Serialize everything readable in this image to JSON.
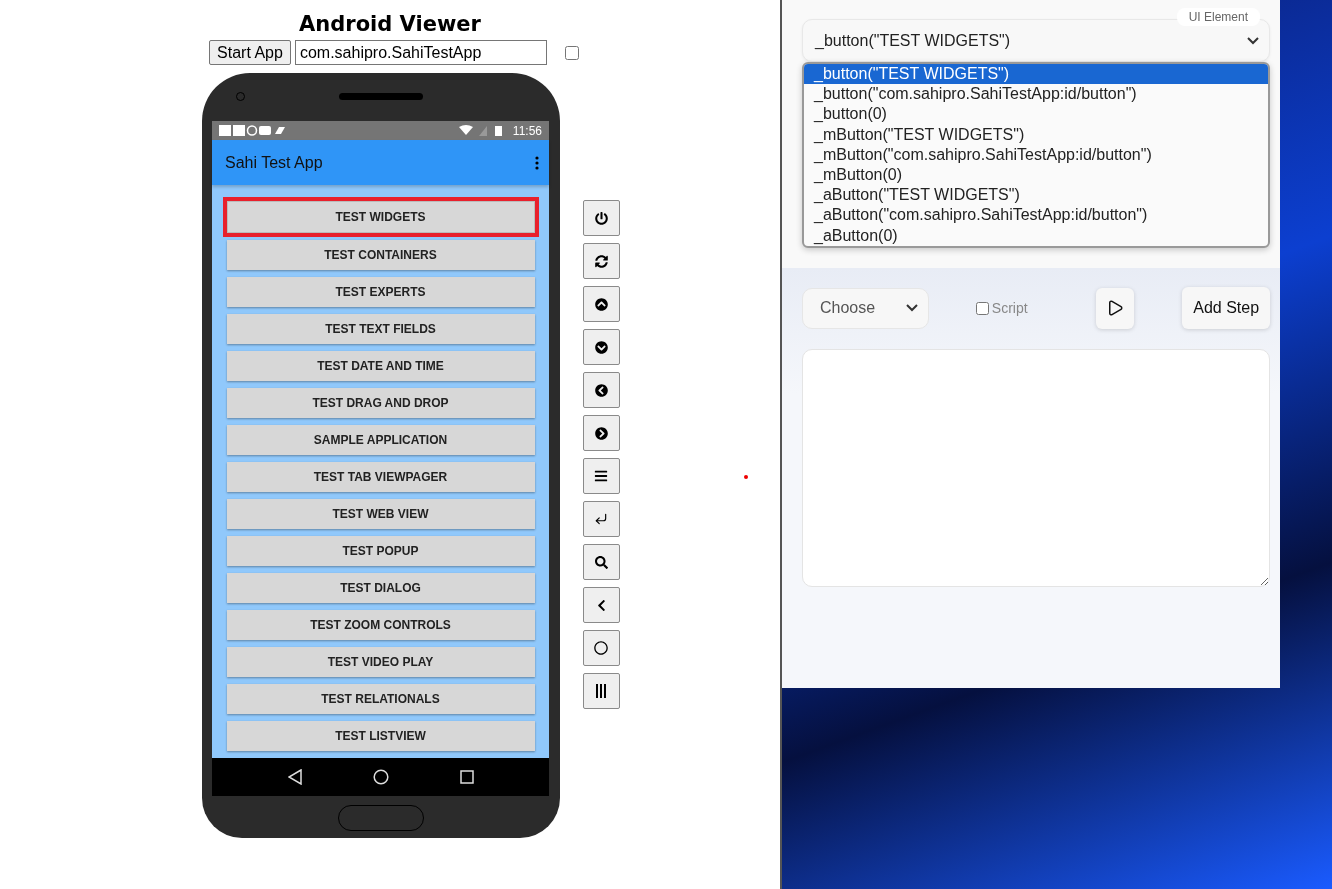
{
  "title": "Android Viewer",
  "start_button": "Start App",
  "package_field": {
    "value": "com.sahipro.SahiTestApp"
  },
  "auto_checkbox": {
    "checked": false
  },
  "phone": {
    "status_time": "11:56",
    "app_title": "Sahi Test App",
    "buttons": [
      {
        "label": "TEST WIDGETS",
        "selected": true
      },
      {
        "label": "TEST CONTAINERS",
        "selected": false
      },
      {
        "label": "TEST EXPERTS",
        "selected": false
      },
      {
        "label": "TEST TEXT FIELDS",
        "selected": false
      },
      {
        "label": "TEST DATE AND TIME",
        "selected": false
      },
      {
        "label": "TEST DRAG AND DROP",
        "selected": false
      },
      {
        "label": "SAMPLE APPLICATION",
        "selected": false
      },
      {
        "label": "TEST TAB VIEWPAGER",
        "selected": false
      },
      {
        "label": "TEST WEB VIEW",
        "selected": false
      },
      {
        "label": "TEST POPUP",
        "selected": false
      },
      {
        "label": "TEST DIALOG",
        "selected": false
      },
      {
        "label": "TEST ZOOM CONTROLS",
        "selected": false
      },
      {
        "label": "TEST VIDEO PLAY",
        "selected": false
      },
      {
        "label": "TEST RELATIONALS",
        "selected": false
      },
      {
        "label": "TEST LISTVIEW",
        "selected": false
      }
    ]
  },
  "ui_element": {
    "label": "UI Element",
    "value": "_button(\"TEST WIDGETS\")",
    "options": [
      {
        "text": "_button(\"TEST WIDGETS\")",
        "selected": true
      },
      {
        "text": "_button(\"com.sahipro.SahiTestApp:id/button\")",
        "selected": false
      },
      {
        "text": "_button(0)",
        "selected": false
      },
      {
        "text": "_mButton(\"TEST WIDGETS\")",
        "selected": false
      },
      {
        "text": "_mButton(\"com.sahipro.SahiTestApp:id/button\")",
        "selected": false
      },
      {
        "text": "_mButton(0)",
        "selected": false
      },
      {
        "text": "_aButton(\"TEST WIDGETS\")",
        "selected": false
      },
      {
        "text": "_aButton(\"com.sahipro.SahiTestApp:id/button\")",
        "selected": false
      },
      {
        "text": "_aButton(0)",
        "selected": false
      }
    ]
  },
  "action_select": {
    "value": "Choose"
  },
  "script_checkbox": {
    "label": "Script",
    "checked": false
  },
  "add_step_button": "Add Step"
}
